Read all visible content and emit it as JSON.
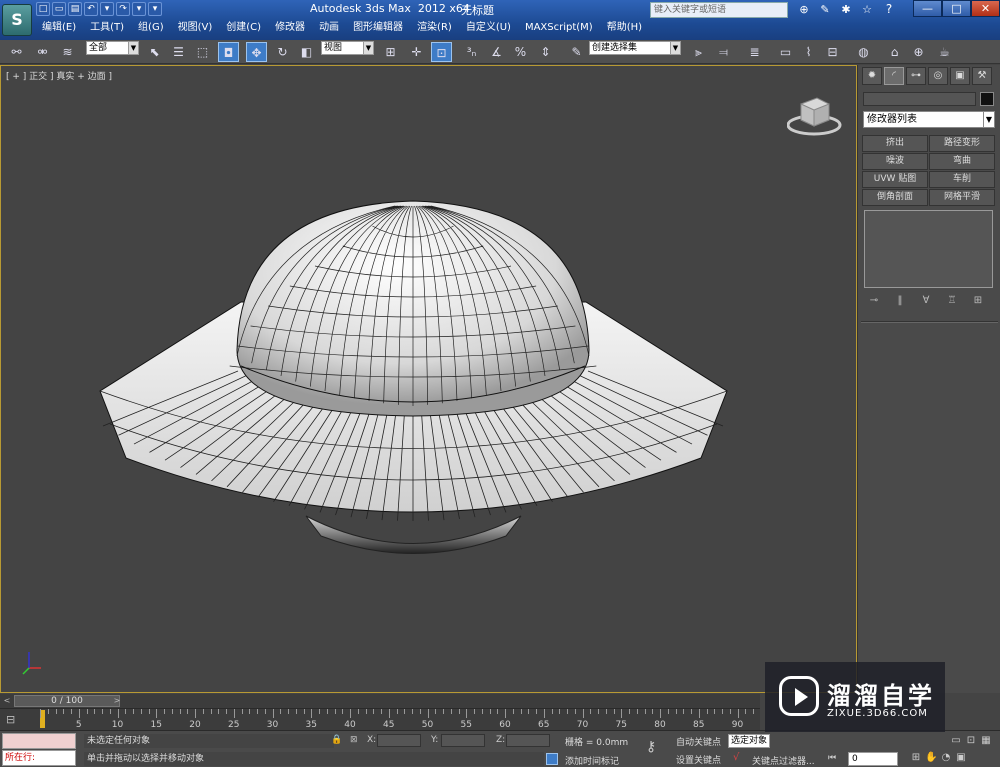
{
  "window": {
    "title": "Autodesk 3ds Max  2012 x64",
    "file_name": "无标题",
    "search_placeholder": "键入关键字或短语",
    "minimize": "—",
    "maximize": "□",
    "close": "✕",
    "help": "?"
  },
  "app_logo": "S",
  "menu": [
    "编辑(E)",
    "工具(T)",
    "组(G)",
    "视图(V)",
    "创建(C)",
    "修改器",
    "动画",
    "图形编辑器",
    "渲染(R)",
    "自定义(U)",
    "MAXScript(M)",
    "帮助(H)"
  ],
  "toolbar": {
    "selection_filter": "全部",
    "reference_coord": "视图",
    "named_selection": "创建选择集"
  },
  "viewport": {
    "label": "[ + ] 正交 ] 真实 + 边面 ]"
  },
  "command_panel": {
    "modifier_list": "修改器列表",
    "modifiers": [
      "挤出",
      "路径变形",
      "噪波",
      "弯曲",
      "UVW 贴图",
      "车削",
      "倒角剖面",
      "网格平滑"
    ]
  },
  "timeline": {
    "slider_label": "0 / 100",
    "ticks": [
      0,
      5,
      10,
      15,
      20,
      25,
      30,
      35,
      40,
      45,
      50,
      55,
      60,
      65,
      70,
      75,
      80,
      85,
      90
    ]
  },
  "status": {
    "running": "所在行:",
    "selection_status": "未选定任何对象",
    "prompt": "单击并拖动以选择并移动对象",
    "x_label": "X:",
    "y_label": "Y:",
    "z_label": "Z:",
    "grid": "栅格 = 0.0mm",
    "add_time_tag": "添加时间标记",
    "auto_key": "自动关键点",
    "set_key": "设置关键点",
    "selected_object": "选定对象",
    "key_filters": "关键点过滤器...",
    "frame": "0"
  },
  "watermark": {
    "brand": "溜溜自学",
    "url": "ZIXUE.3D66.COM"
  }
}
